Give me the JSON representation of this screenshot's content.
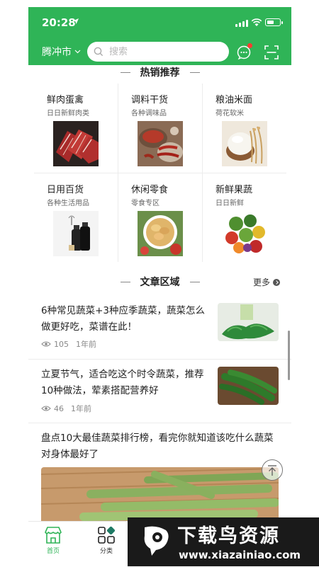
{
  "status_bar": {
    "time": "20:28"
  },
  "header": {
    "city": "腾冲市",
    "search_placeholder": "搜索"
  },
  "hot_section": {
    "title": "热销推荐"
  },
  "categories": [
    {
      "name": "鲜肉蛋禽",
      "desc": "日日新鲜肉类"
    },
    {
      "name": "调料干货",
      "desc": "各种调味品"
    },
    {
      "name": "粮油米面",
      "desc": "荷花软米"
    },
    {
      "name": "日用百货",
      "desc": "各种生活用品"
    },
    {
      "name": "休闲零食",
      "desc": "零食专区"
    },
    {
      "name": "新鲜果蔬",
      "desc": "日日新鲜"
    }
  ],
  "article_section": {
    "title": "文章区域",
    "more_label": "更多"
  },
  "articles": [
    {
      "title": "6种常见蔬菜+3种应季蔬菜，蔬菜怎么做更好吃，菜谱在此！",
      "views": "105",
      "time": "1年前"
    },
    {
      "title": "立夏节气，适合吃这个时令蔬菜，推荐10种做法，荤素搭配营养好",
      "views": "46",
      "time": "1年前"
    },
    {
      "title": "盘点10大最佳蔬菜排行榜，看完你就知道该吃什么蔬菜对身体最好了"
    }
  ],
  "tabbar": {
    "items": [
      {
        "label": "首页",
        "active": true
      },
      {
        "label": "分类",
        "active": false
      }
    ]
  },
  "watermark": {
    "text": "下载鸟资源",
    "url": "www.xiazainiao.com"
  },
  "colors": {
    "brand": "#2fb457",
    "badge": "#ff3b30"
  }
}
